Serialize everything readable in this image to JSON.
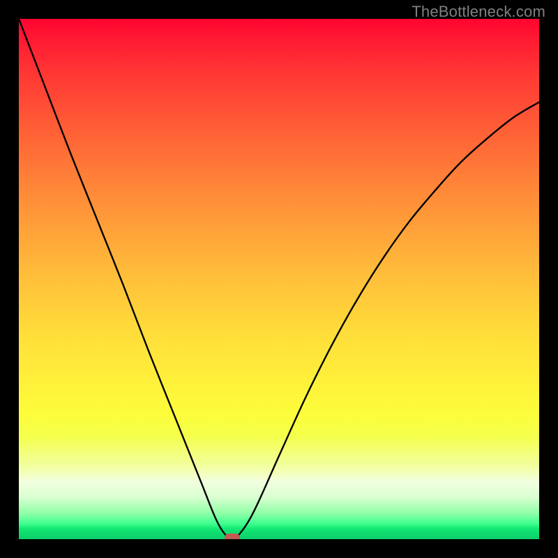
{
  "watermark": "TheBottleneck.com",
  "chart_data": {
    "type": "line",
    "title": "",
    "xlabel": "",
    "ylabel": "",
    "xlim": [
      0,
      100
    ],
    "ylim": [
      0,
      100
    ],
    "grid": false,
    "background": "red-yellow-green vertical gradient",
    "series": [
      {
        "name": "bottleneck-curve",
        "x": [
          0,
          5,
          10,
          15,
          20,
          25,
          30,
          35,
          38,
          40,
          41,
          42,
          45,
          50,
          55,
          60,
          65,
          70,
          75,
          80,
          85,
          90,
          95,
          100
        ],
        "y": [
          100,
          87,
          74,
          61.5,
          49,
          36,
          23.5,
          11,
          3.6,
          0.5,
          0,
          0.5,
          5,
          16,
          27,
          37,
          46,
          54,
          61,
          67,
          72.5,
          77,
          81,
          84
        ]
      }
    ],
    "marker": {
      "name": "optimum-point",
      "x": 41,
      "y": 0,
      "color": "#c35a54"
    },
    "colors": {
      "curve": "#000000",
      "gradient_top": "#ff0430",
      "gradient_mid": "#ffdc3a",
      "gradient_bottom": "#0ed06b",
      "frame": "#000000"
    }
  }
}
